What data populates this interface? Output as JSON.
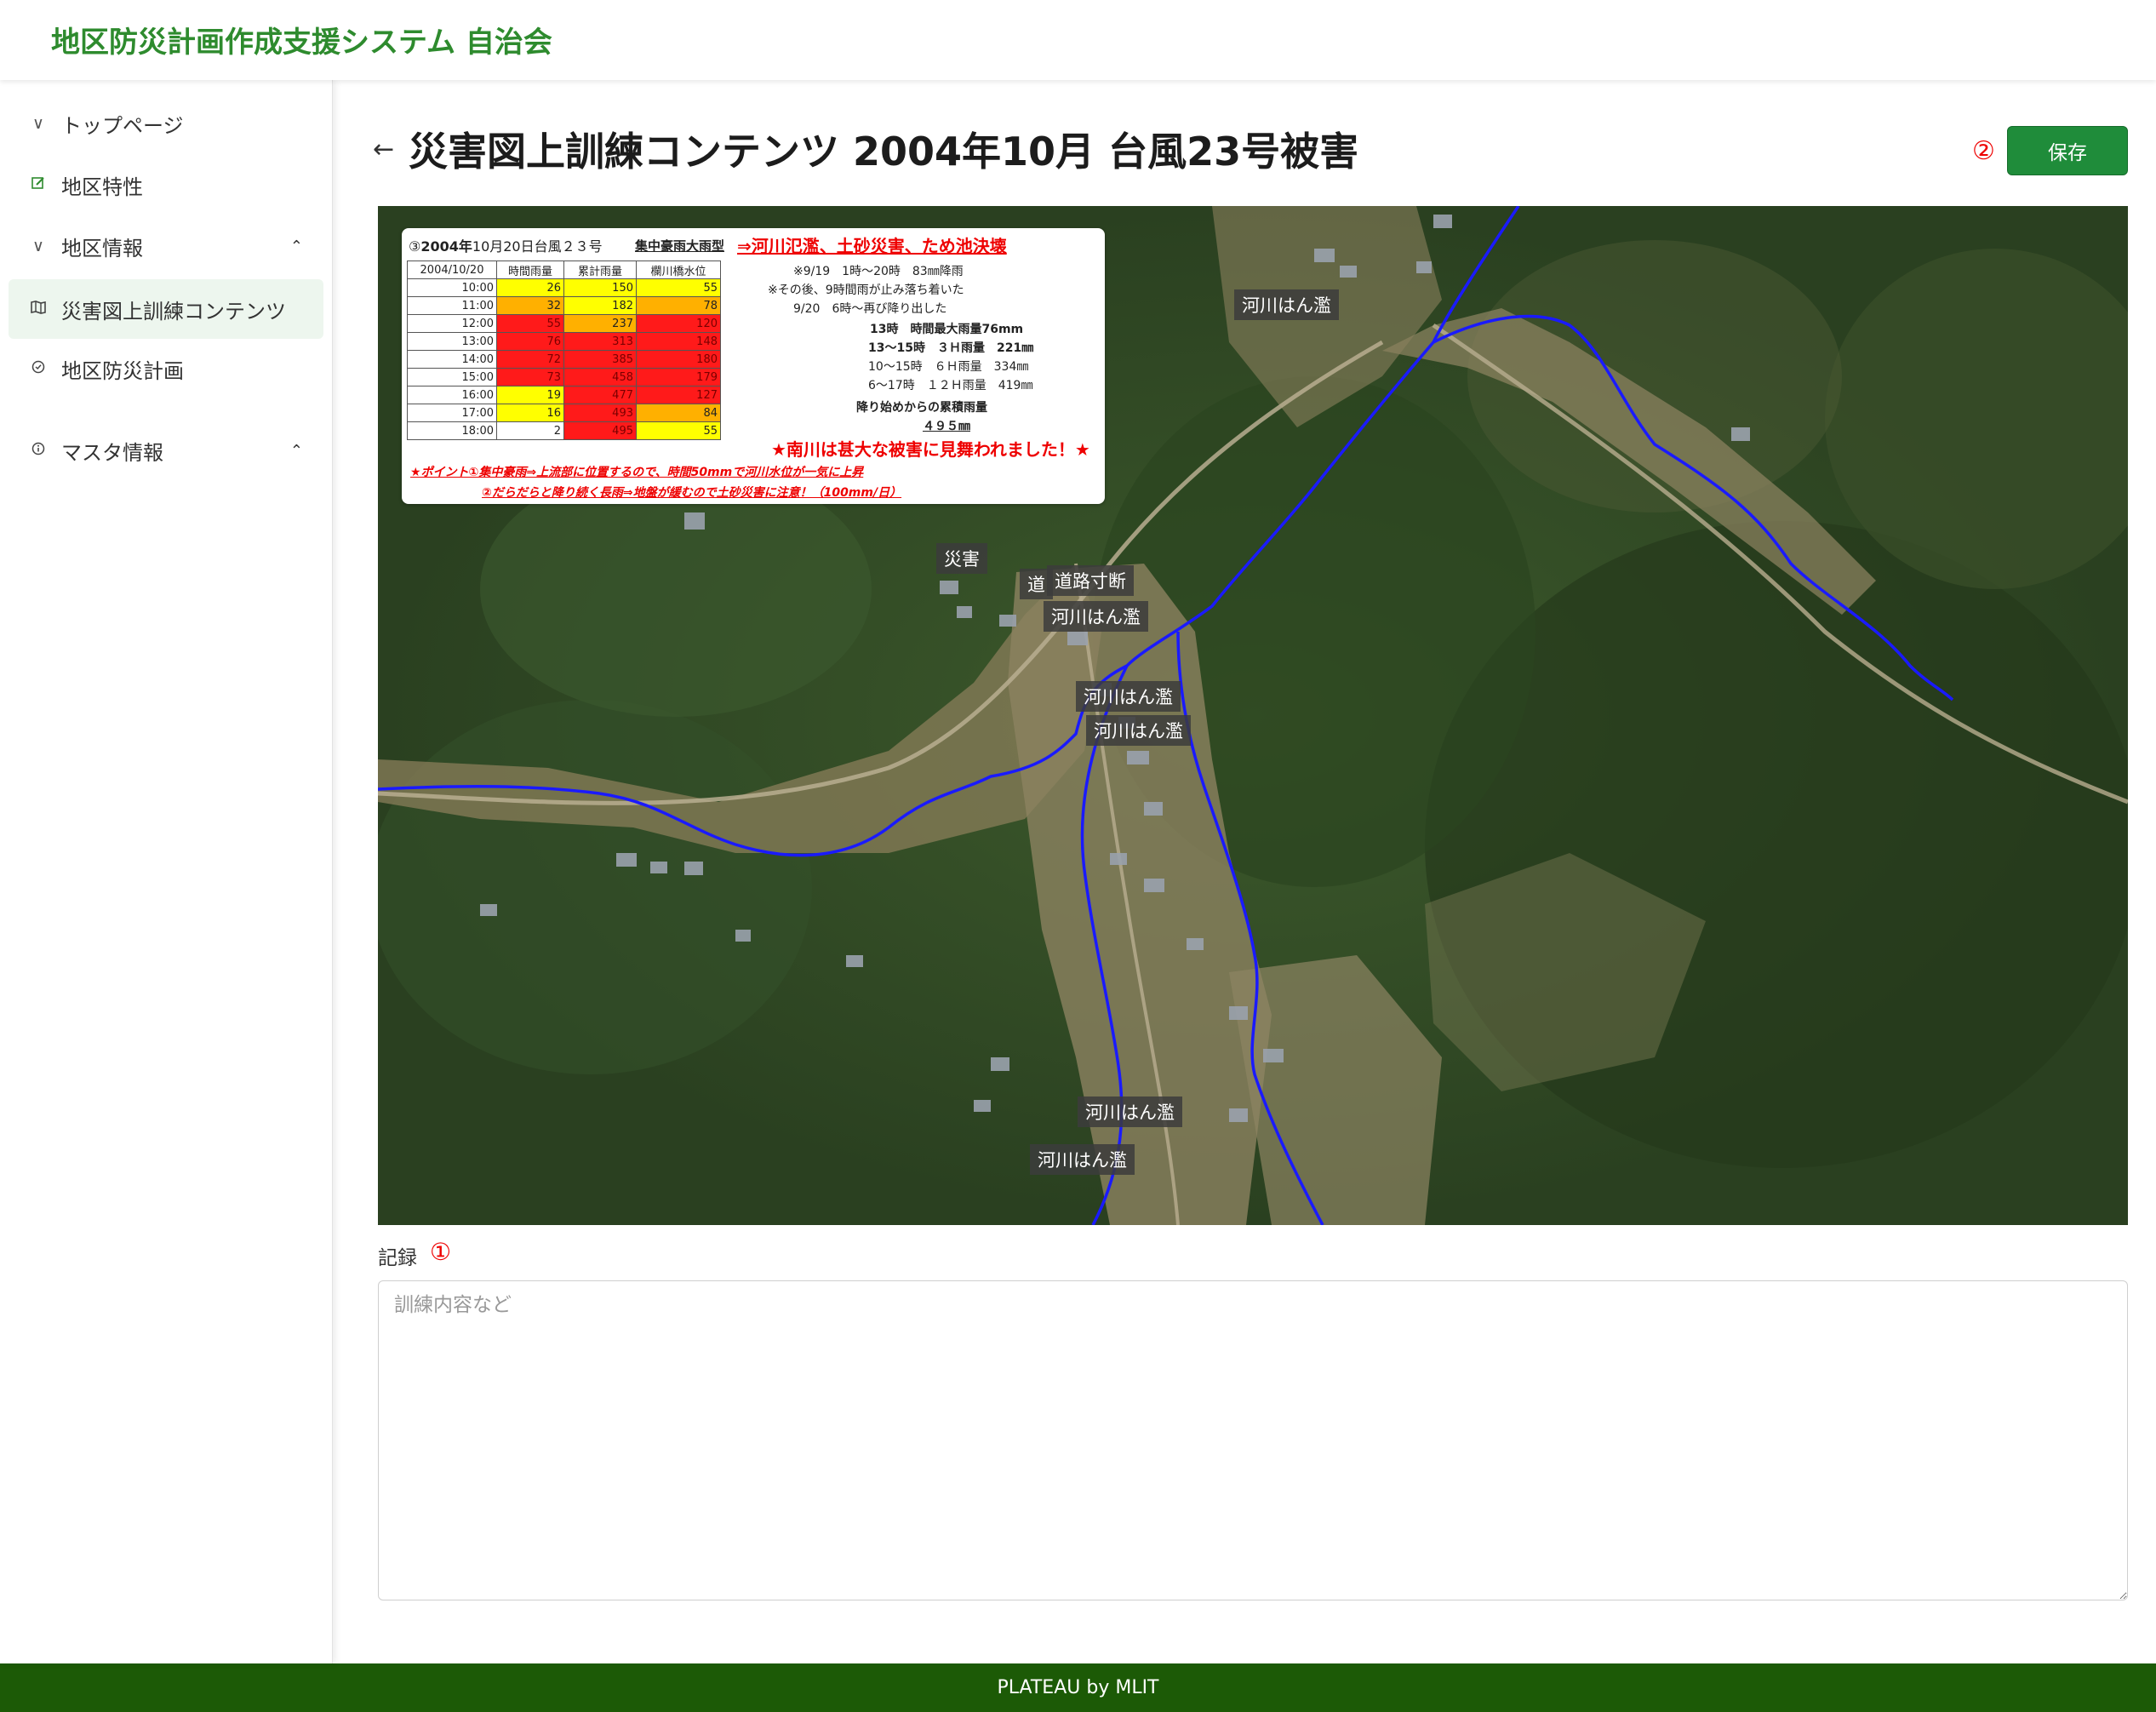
{
  "header": {
    "title": "地区防災計画作成支援システム 自治会"
  },
  "sidebar": {
    "items": [
      {
        "label": "トップページ",
        "icon": "chevron-down-icon"
      },
      {
        "label": "地区特性",
        "icon": "edit-icon"
      },
      {
        "label": "地区情報",
        "icon": "chevron-down-icon",
        "caret": "⌃"
      },
      {
        "label": "災害図上訓練コンテンツ",
        "icon": "map-icon",
        "active": true
      },
      {
        "label": "地区防災計画",
        "icon": "check-circle-icon"
      },
      {
        "label": "マスタ情報",
        "icon": "info-icon",
        "caret": "⌃"
      }
    ]
  },
  "page": {
    "title": "災害図上訓練コンテンツ 2004年10月 台風23号被害",
    "save_label": "保存",
    "save_marker": "②"
  },
  "map": {
    "labels": [
      "河川はん濫",
      "災害",
      "道",
      "道路寸断",
      "河川はん濫",
      "河川はん濫",
      "河川はん濫",
      "河川はん濫",
      "河川はん濫"
    ],
    "info_panel": {
      "heading_prefix": "③",
      "heading_year": "2004年",
      "heading_rest": "10月20日台風２３号",
      "type_label": "集中豪雨大雨型",
      "type_result": "⇒河川氾濫、土砂災害、ため池決壊",
      "columns": [
        "2004/10/20",
        "時間雨量",
        "累計雨量",
        "欄川橋水位"
      ],
      "rows": [
        [
          "10:00",
          "26",
          "150",
          "55"
        ],
        [
          "11:00",
          "32",
          "182",
          "78"
        ],
        [
          "12:00",
          "55",
          "237",
          "120"
        ],
        [
          "13:00",
          "76",
          "313",
          "148"
        ],
        [
          "14:00",
          "72",
          "385",
          "180"
        ],
        [
          "15:00",
          "73",
          "458",
          "179"
        ],
        [
          "16:00",
          "19",
          "477",
          "127"
        ],
        [
          "17:00",
          "16",
          "493",
          "84"
        ],
        [
          "18:00",
          "2",
          "495",
          "55"
        ]
      ],
      "notes": [
        "※9/19　1時～20時　83㎜降雨",
        "※その後、9時間雨が止み落ち着いた",
        "9/20　6時～再び降り出した",
        "13時　時間最大雨量76mm",
        "13～15時　３Ｈ雨量　221㎜",
        "10～15時　６Ｈ雨量　334㎜",
        "6～17時　１２Ｈ雨量　419㎜",
        "降り始めからの累積雨量",
        "４９５㎜"
      ],
      "warning": "★南川は甚大な被害に見舞われました！★",
      "points": [
        "★ポイント①集中豪雨⇒上流部に位置するので、時間50mmで河川水位が一気に上昇",
        "②だらだらと降り続く長雨⇒地盤が緩むので土砂災害に注意！（100mm/日）"
      ]
    }
  },
  "record": {
    "label": "記録",
    "marker": "①",
    "placeholder": "訓練内容など"
  },
  "footer": {
    "text": "PLATEAU by MLIT"
  },
  "colors": {
    "brand": "#2e8b2e",
    "save_button": "#1f8c3a",
    "footer": "#1c5a06",
    "river": "#1a1aff",
    "marker": "#e00000"
  }
}
